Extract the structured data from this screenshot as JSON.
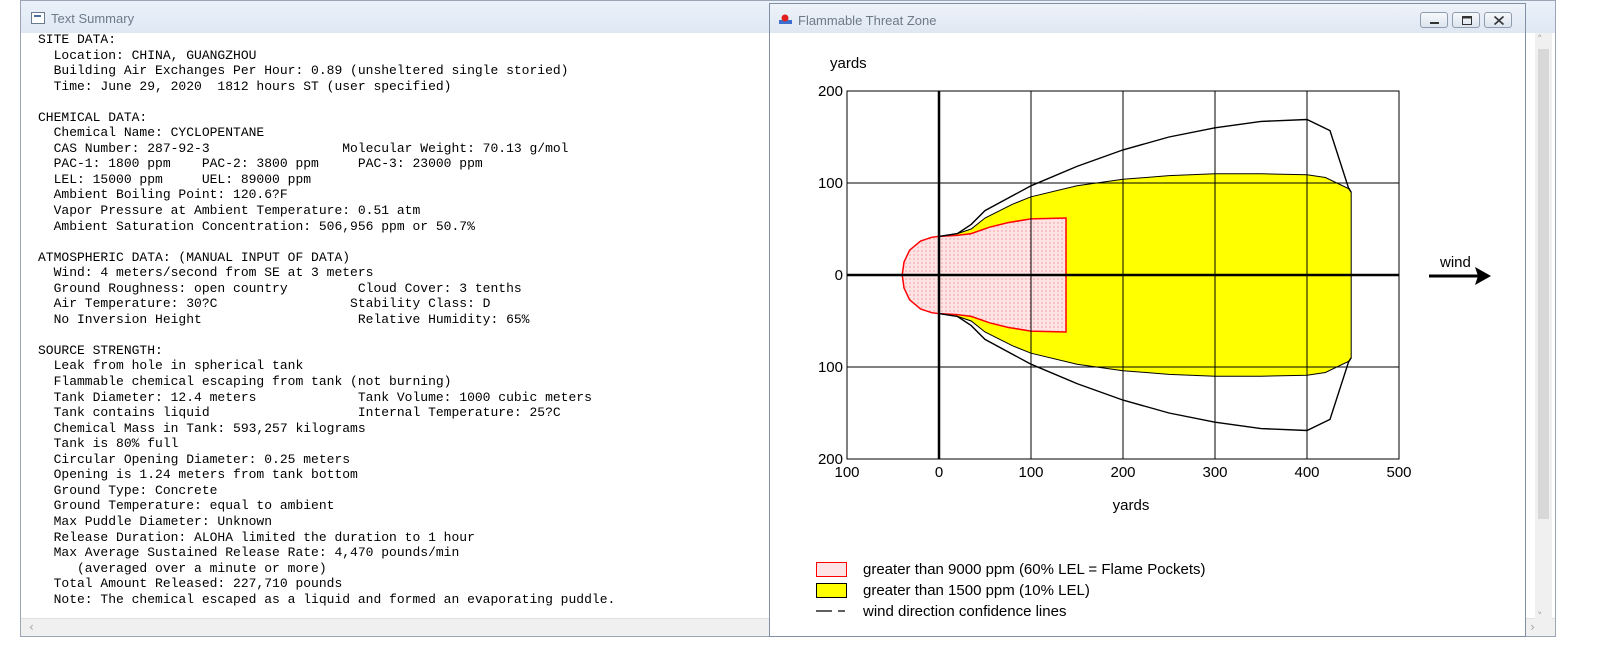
{
  "text_window": {
    "title": "Text Summary",
    "lines": [
      "SITE DATA:",
      "  Location: CHINA, GUANGZHOU",
      "  Building Air Exchanges Per Hour: 0.89 (unsheltered single storied)",
      "  Time: June 29, 2020  1812 hours ST (user specified)",
      "",
      "CHEMICAL DATA:",
      "  Chemical Name: CYCLOPENTANE",
      "  CAS Number: 287-92-3                 Molecular Weight: 70.13 g/mol",
      "  PAC-1: 1800 ppm    PAC-2: 3800 ppm     PAC-3: 23000 ppm",
      "  LEL: 15000 ppm     UEL: 89000 ppm",
      "  Ambient Boiling Point: 120.6?F",
      "  Vapor Pressure at Ambient Temperature: 0.51 atm",
      "  Ambient Saturation Concentration: 506,956 ppm or 50.7%",
      "",
      "ATMOSPHERIC DATA: (MANUAL INPUT OF DATA)",
      "  Wind: 4 meters/second from SE at 3 meters",
      "  Ground Roughness: open country         Cloud Cover: 3 tenths",
      "  Air Temperature: 30?C                 Stability Class: D",
      "  No Inversion Height                    Relative Humidity: 65%",
      "",
      "SOURCE STRENGTH:",
      "  Leak from hole in spherical tank",
      "  Flammable chemical escaping from tank (not burning)",
      "  Tank Diameter: 12.4 meters             Tank Volume: 1000 cubic meters",
      "  Tank contains liquid                   Internal Temperature: 25?C",
      "  Chemical Mass in Tank: 593,257 kilograms",
      "  Tank is 80% full",
      "  Circular Opening Diameter: 0.25 meters",
      "  Opening is 1.24 meters from tank bottom",
      "  Ground Type: Concrete",
      "  Ground Temperature: equal to ambient",
      "  Max Puddle Diameter: Unknown",
      "  Release Duration: ALOHA limited the duration to 1 hour",
      "  Max Average Sustained Release Rate: 4,470 pounds/min",
      "     (averaged over a minute or more)",
      "  Total Amount Released: 227,710 pounds",
      "  Note: The chemical escaped as a liquid and formed an evaporating puddle."
    ]
  },
  "threat_window": {
    "title": "Flammable Threat Zone",
    "wind_label": "wind",
    "legend": [
      {
        "label": "greater than 9000 ppm (60% LEL = Flame Pockets)",
        "color": "#ffe4e6",
        "border": "#ff0000"
      },
      {
        "label": "greater than 1500 ppm (10% LEL)",
        "color": "#ffff00",
        "border": "#000000"
      },
      {
        "label": "wind direction confidence lines",
        "color": "#000000",
        "border": "#000000"
      }
    ]
  },
  "chart_data": {
    "type": "area",
    "xlabel": "yards",
    "ylabel": "yards",
    "xlim": [
      -100,
      500
    ],
    "ylim": [
      -200,
      200
    ],
    "x_tick_labels": [
      "100",
      "0",
      "100",
      "200",
      "300",
      "400",
      "500"
    ],
    "y_tick_labels": [
      "200",
      "100",
      "0",
      "100",
      "200"
    ],
    "grid": true,
    "series": [
      {
        "name": "greater than 1500 ppm (10% LEL)",
        "color": "#ffff00",
        "points": [
          [
            0,
            42
          ],
          [
            20,
            45
          ],
          [
            35,
            50
          ],
          [
            50,
            62
          ],
          [
            80,
            77
          ],
          [
            100,
            85
          ],
          [
            150,
            97
          ],
          [
            200,
            104
          ],
          [
            250,
            108
          ],
          [
            300,
            110
          ],
          [
            350,
            110
          ],
          [
            400,
            109
          ],
          [
            420,
            106
          ],
          [
            445,
            94
          ],
          [
            448,
            90
          ],
          [
            448,
            -90
          ],
          [
            445,
            -94
          ],
          [
            420,
            -106
          ],
          [
            400,
            -109
          ],
          [
            350,
            -110
          ],
          [
            300,
            -110
          ],
          [
            250,
            -108
          ],
          [
            200,
            -104
          ],
          [
            150,
            -97
          ],
          [
            100,
            -85
          ],
          [
            80,
            -77
          ],
          [
            50,
            -62
          ],
          [
            35,
            -50
          ],
          [
            20,
            -45
          ],
          [
            0,
            -42
          ]
        ]
      },
      {
        "name": "greater than 9000 ppm (60% LEL = Flame Pockets)",
        "color": "#ffe4e6",
        "points": [
          [
            -40,
            0
          ],
          [
            -38,
            -14
          ],
          [
            -32,
            -27
          ],
          [
            -20,
            -37
          ],
          [
            -8,
            -41
          ],
          [
            0,
            -42
          ],
          [
            20,
            -43
          ],
          [
            35,
            -45
          ],
          [
            55,
            -52
          ],
          [
            75,
            -57
          ],
          [
            100,
            -61
          ],
          [
            138,
            -62
          ],
          [
            138,
            62
          ],
          [
            100,
            61
          ],
          [
            75,
            57
          ],
          [
            55,
            52
          ],
          [
            35,
            45
          ],
          [
            20,
            43
          ],
          [
            0,
            42
          ],
          [
            -8,
            41
          ],
          [
            -20,
            37
          ],
          [
            -32,
            27
          ],
          [
            -38,
            14
          ]
        ]
      },
      {
        "name": "wind direction confidence lines",
        "color": "#000000",
        "points": [
          [
            0,
            42
          ],
          [
            20,
            45
          ],
          [
            35,
            55
          ],
          [
            50,
            70
          ],
          [
            100,
            97
          ],
          [
            150,
            118
          ],
          [
            200,
            136
          ],
          [
            250,
            150
          ],
          [
            300,
            160
          ],
          [
            350,
            167
          ],
          [
            400,
            169
          ],
          [
            425,
            157
          ],
          [
            445,
            95
          ],
          [
            448,
            90
          ]
        ]
      },
      {
        "name": "wind direction confidence lines (lower)",
        "color": "#000000",
        "points": [
          [
            0,
            -42
          ],
          [
            20,
            -45
          ],
          [
            35,
            -55
          ],
          [
            50,
            -70
          ],
          [
            100,
            -97
          ],
          [
            150,
            -118
          ],
          [
            200,
            -136
          ],
          [
            250,
            -150
          ],
          [
            300,
            -160
          ],
          [
            350,
            -167
          ],
          [
            400,
            -169
          ],
          [
            425,
            -157
          ],
          [
            445,
            -95
          ],
          [
            448,
            -90
          ]
        ]
      }
    ]
  }
}
